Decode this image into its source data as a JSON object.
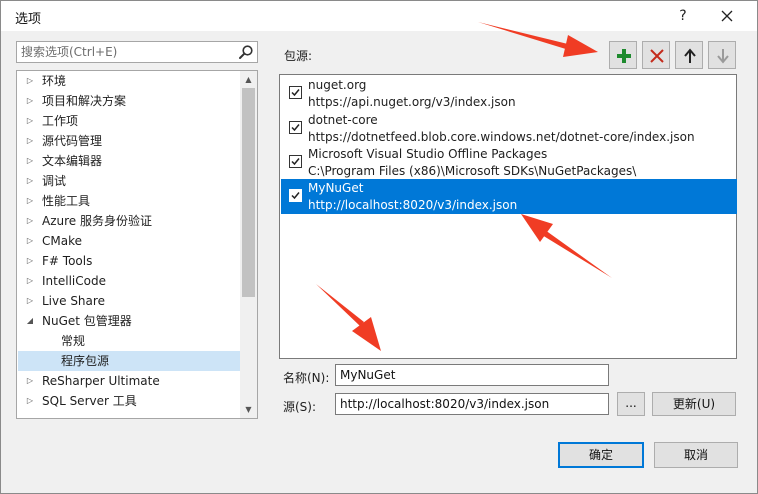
{
  "window": {
    "title": "选项",
    "help_label": "?"
  },
  "search": {
    "placeholder": "搜索选项(Ctrl+E)"
  },
  "tree": {
    "items": [
      {
        "label": "环境",
        "expanded": false
      },
      {
        "label": "项目和解决方案",
        "expanded": false
      },
      {
        "label": "工作项",
        "expanded": false
      },
      {
        "label": "源代码管理",
        "expanded": false
      },
      {
        "label": "文本编辑器",
        "expanded": false
      },
      {
        "label": "调试",
        "expanded": false
      },
      {
        "label": "性能工具",
        "expanded": false
      },
      {
        "label": "Azure 服务身份验证",
        "expanded": false
      },
      {
        "label": "CMake",
        "expanded": false
      },
      {
        "label": "F# Tools",
        "expanded": false
      },
      {
        "label": "IntelliCode",
        "expanded": false
      },
      {
        "label": "Live Share",
        "expanded": false
      },
      {
        "label": "NuGet 包管理器",
        "expanded": true
      },
      {
        "label": "常规",
        "child": true
      },
      {
        "label": "程序包源",
        "child": true,
        "selected": true
      },
      {
        "label": "ReSharper Ultimate",
        "expanded": false
      },
      {
        "label": "SQL Server 工具",
        "expanded": false
      }
    ]
  },
  "sources": {
    "label": "包源:",
    "items": [
      {
        "name": "nuget.org",
        "source": "https://api.nuget.org/v3/index.json",
        "checked": true,
        "selected": false
      },
      {
        "name": "dotnet-core",
        "source": "https://dotnetfeed.blob.core.windows.net/dotnet-core/index.json",
        "checked": true,
        "selected": false
      },
      {
        "name": "Microsoft Visual Studio Offline Packages",
        "source": "C:\\Program Files (x86)\\Microsoft SDKs\\NuGetPackages\\",
        "checked": true,
        "selected": false
      },
      {
        "name": "MyNuGet",
        "source": "http://localhost:8020/v3/index.json",
        "checked": true,
        "selected": true
      }
    ]
  },
  "form": {
    "name_label": "名称(N):",
    "name_value": "MyNuGet",
    "source_label": "源(S):",
    "source_value": "http://localhost:8020/v3/index.json",
    "browse_label": "...",
    "update_label": "更新(U)"
  },
  "footer": {
    "ok_label": "确定",
    "cancel_label": "取消"
  },
  "colors": {
    "selection": "#0078d7",
    "add_icon": "#1e8a2e",
    "remove_icon": "#c42b1c",
    "annotation_arrow": "#f03c24"
  },
  "icons": [
    "search-icon",
    "add-icon",
    "remove-icon",
    "move-up-icon",
    "move-down-icon",
    "close-icon",
    "checkbox-check-icon",
    "expand-arrow-icon",
    "collapse-arrow-icon"
  ]
}
